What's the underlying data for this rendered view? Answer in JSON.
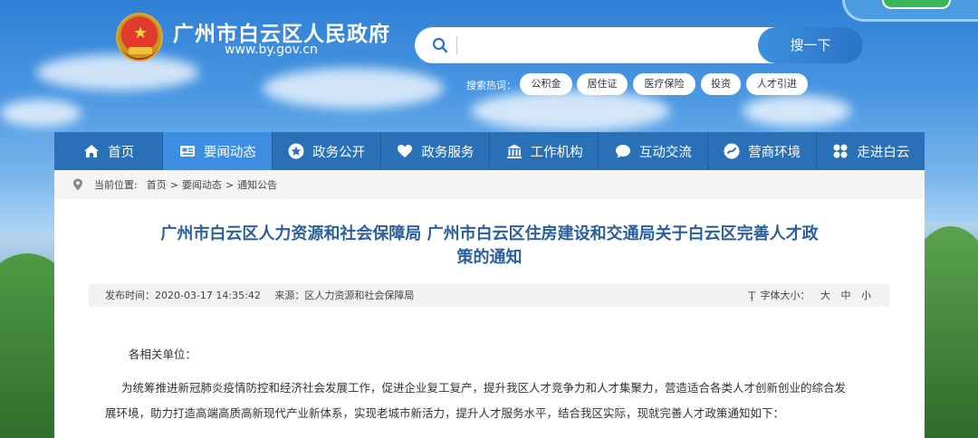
{
  "header": {
    "site_title": "广州市白云区人民政府",
    "site_url": "www.by.gov.cn"
  },
  "search": {
    "placeholder": "",
    "button_label": "搜一下",
    "hot_label": "搜索热词：",
    "hot_tags": [
      "公积金",
      "居住证",
      "医疗保险",
      "投资",
      "人才引进"
    ]
  },
  "nav": {
    "items": [
      {
        "label": "首页",
        "icon": "home-icon"
      },
      {
        "label": "要闻动态",
        "icon": "news-icon"
      },
      {
        "label": "政务公开",
        "icon": "star-icon"
      },
      {
        "label": "政务服务",
        "icon": "heart-icon"
      },
      {
        "label": "工作机构",
        "icon": "building-icon"
      },
      {
        "label": "互动交流",
        "icon": "chat-icon"
      },
      {
        "label": "营商环境",
        "icon": "business-icon"
      },
      {
        "label": "走进白云",
        "icon": "flower-icon"
      }
    ],
    "active_index": 1
  },
  "breadcrumb": {
    "label": "当前位置:",
    "items": [
      "首页",
      ">",
      "要闻动态",
      ">",
      "通知公告"
    ]
  },
  "article": {
    "title_line1": "广州市白云区人力资源和社会保障局 广州市白云区住房建设和交通局关于白云区完善人才政",
    "title_line2": "策的通知",
    "publish_time": "发布时间：2020-03-17 14:35:42",
    "source": "来源：区人力资源和社会保障局",
    "font_size_label": "字体大小：",
    "font_sizes": [
      "大",
      "中",
      "小"
    ],
    "greeting": "各相关单位：",
    "paragraph_line1": "为统筹推进新冠肺炎疫情防控和经济社会发展工作，促进企业复工复产，提升我区人才竞争力和人才集聚力，营造适合各类人才创新创业的综合发",
    "paragraph_line2": "展环境，助力打造高端高质高新现代产业新体系，实现老城市新活力，提升人才服务水平，结合我区实际，现就完善人才政策通知如下："
  },
  "colors": {
    "nav_bg": "#2a70b6",
    "nav_active": "#3d8ee0",
    "title_color": "#2a5f9c"
  }
}
